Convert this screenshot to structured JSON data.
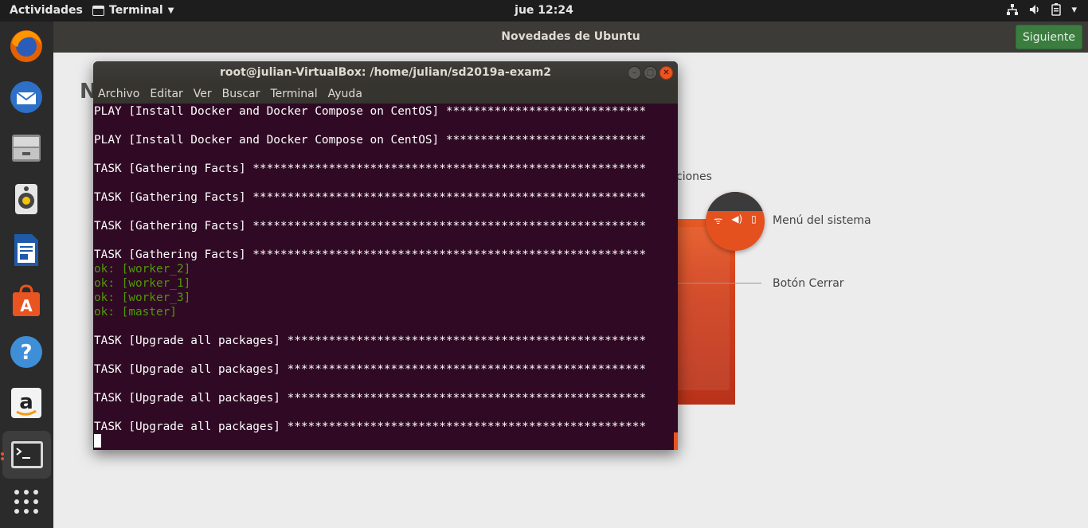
{
  "topbar": {
    "activities": "Actividades",
    "app_name": "Terminal",
    "clock": "jue 12:24",
    "tray_icons": [
      "network-icon",
      "volume-icon",
      "battery-icon"
    ]
  },
  "dock": {
    "items": [
      "firefox-icon",
      "thunderbird-icon",
      "files-icon",
      "rhythmbox-icon",
      "libreoffice-writer-icon",
      "software-center-icon",
      "help-icon",
      "amazon-icon",
      "terminal-icon",
      "app-grid-icon"
    ]
  },
  "welcome": {
    "title": "Novedades de Ubuntu",
    "next_button": "Siguiente",
    "heading_fragment": "N",
    "callout_fragment": "ciones",
    "label_system_menu": "Menú del sistema",
    "label_close_button": "Botón Cerrar"
  },
  "terminal": {
    "title": "root@julian-VirtualBox: /home/julian/sd2019a-exam2",
    "menu": [
      "Archivo",
      "Editar",
      "Ver",
      "Buscar",
      "Terminal",
      "Ayuda"
    ],
    "lines": [
      {
        "text": "PLAY [Install Docker and Docker Compose on CentOS] *****************************",
        "type": "normal"
      },
      {
        "text": "",
        "type": "normal"
      },
      {
        "text": "PLAY [Install Docker and Docker Compose on CentOS] *****************************",
        "type": "normal"
      },
      {
        "text": "",
        "type": "normal"
      },
      {
        "text": "TASK [Gathering Facts] *********************************************************",
        "type": "normal"
      },
      {
        "text": "",
        "type": "normal"
      },
      {
        "text": "TASK [Gathering Facts] *********************************************************",
        "type": "normal"
      },
      {
        "text": "",
        "type": "normal"
      },
      {
        "text": "TASK [Gathering Facts] *********************************************************",
        "type": "normal"
      },
      {
        "text": "",
        "type": "normal"
      },
      {
        "text": "TASK [Gathering Facts] *********************************************************",
        "type": "normal"
      },
      {
        "text": "ok: [worker_2]",
        "type": "ok"
      },
      {
        "text": "ok: [worker_1]",
        "type": "ok"
      },
      {
        "text": "ok: [worker_3]",
        "type": "ok"
      },
      {
        "text": "ok: [master]",
        "type": "ok"
      },
      {
        "text": "",
        "type": "normal"
      },
      {
        "text": "TASK [Upgrade all packages] ****************************************************",
        "type": "normal"
      },
      {
        "text": "",
        "type": "normal"
      },
      {
        "text": "TASK [Upgrade all packages] ****************************************************",
        "type": "normal"
      },
      {
        "text": "",
        "type": "normal"
      },
      {
        "text": "TASK [Upgrade all packages] ****************************************************",
        "type": "normal"
      },
      {
        "text": "",
        "type": "normal"
      },
      {
        "text": "TASK [Upgrade all packages] ****************************************************",
        "type": "normal"
      }
    ]
  },
  "colors": {
    "terminal_bg": "#300a24",
    "ok_text": "#4e9a06",
    "ubuntu_orange": "#e95420",
    "next_button": "#3a7d3e"
  }
}
